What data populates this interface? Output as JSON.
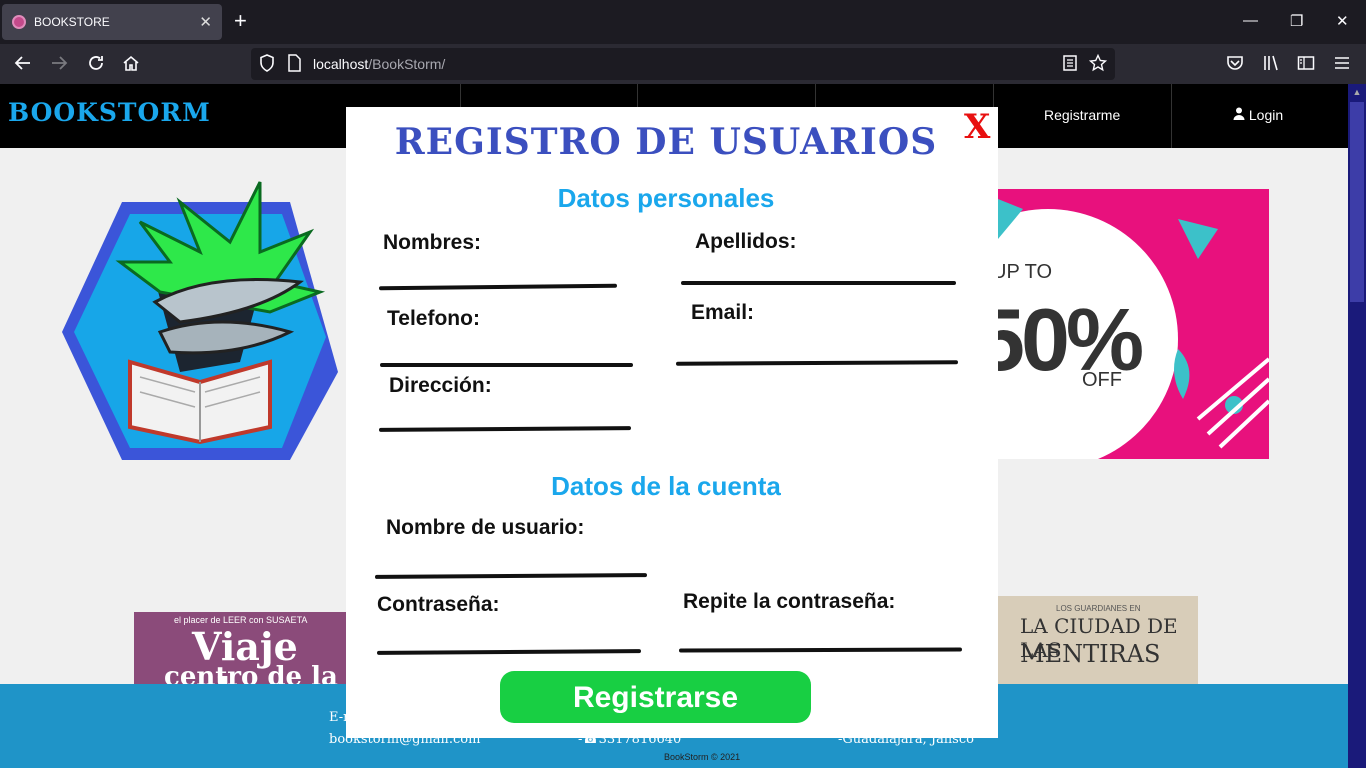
{
  "browser": {
    "tab_title": "BOOKSTORE",
    "tab_close": "✕",
    "new_tab": "+",
    "url_host": "localhost",
    "url_path": "/BookStorm/",
    "window_controls": {
      "minimize": "—",
      "restore": "❐",
      "close": "✕"
    }
  },
  "site": {
    "brand": "BOOKSTORM",
    "menu": {
      "register": "Registrarme",
      "login": "Login"
    }
  },
  "promo": {
    "upto": "UP TO",
    "percent": "50%",
    "off": "OFF"
  },
  "books": {
    "book1": {
      "top_line": "el placer de LEER con SUSAETA",
      "title_a": "Viaje al",
      "title_b": "centro de la"
    },
    "book2": {
      "top_line": "LOS GUARDIANES EN",
      "title_a": "LA CIUDAD DE LAS",
      "title_b": "MENTIRAS"
    }
  },
  "footer": {
    "email_label": "E-mail",
    "email": "bookstorm@gmail.com",
    "phone": "-☎3317816640",
    "city": "-Guadalajara, Jalisco",
    "copyright": "BookStorm © 2021"
  },
  "modal": {
    "close_label": "X",
    "title": "REGISTRO DE USUARIOS",
    "section_personal": "Datos personales",
    "section_account": "Datos de la cuenta",
    "fields": {
      "nombres": "Nombres:",
      "apellidos": "Apellidos:",
      "telefono": "Telefono:",
      "email": "Email:",
      "direccion": "Dirección:",
      "usuario": "Nombre de usuario:",
      "contrasena": "Contraseña:",
      "repite": "Repite la contraseña:"
    },
    "submit": "Registrarse"
  },
  "colors": {
    "brand_blue": "#1aa7ec",
    "title_blue": "#3b4fbf",
    "submit_green": "#18cf43",
    "close_red": "#e81010",
    "footer_blue": "#1f94c8",
    "promo_pink": "#e8117d"
  }
}
